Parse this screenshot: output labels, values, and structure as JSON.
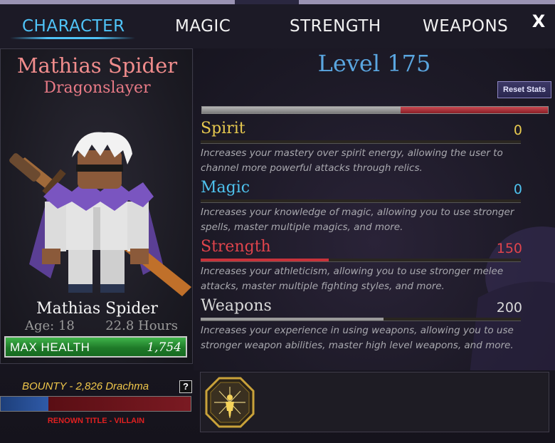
{
  "tabs": [
    {
      "label": "CHARACTER",
      "active": true
    },
    {
      "label": "MAGIC",
      "active": false
    },
    {
      "label": "STRENGTH",
      "active": false
    },
    {
      "label": "WEAPONS",
      "active": false
    }
  ],
  "close_label": "X",
  "character": {
    "name": "Mathias Spider",
    "title": "Dragonslayer",
    "display_name": "Mathias Spider",
    "age": "Age: 18",
    "playtime": "22.8 Hours"
  },
  "health": {
    "label": "MAX HEALTH",
    "value": "1,754"
  },
  "bounty": {
    "text": "BOUNTY - 2,826 Drachma",
    "help_label": "?"
  },
  "renown": {
    "title": "RENOWN TITLE - VILLAIN",
    "fraction": 0.25
  },
  "level": {
    "text": "Level 175",
    "xp_fraction": 0.575
  },
  "reset_button": "Reset Stats",
  "stats": [
    {
      "name": "Spirit",
      "value": "0",
      "fraction": 0.0,
      "color": "#e7c94f",
      "bar_color": "#8a7a2a",
      "desc": "Increases your mastery over spirit energy, allowing the user to channel more powerful attacks through relics."
    },
    {
      "name": "Magic",
      "value": "0",
      "fraction": 0.0,
      "color": "#4ec2ee",
      "bar_color": "#2a7aa0",
      "desc": "Increases your knowledge of magic, allowing you to use stronger spells, master multiple magics, and more."
    },
    {
      "name": "Strength",
      "value": "150",
      "fraction": 0.4,
      "color": "#e0444c",
      "bar_color": "#c8323a",
      "desc": "Increases your athleticism, allowing you to use stronger melee attacks, master multiple fighting styles, and more."
    },
    {
      "name": "Weapons",
      "value": "200",
      "fraction": 0.57,
      "color": "#d9d9d9",
      "bar_color": "#9a9a9a",
      "desc": "Increases your experience in using weapons, allowing you to use stronger weapon abilities, master high level weapons, and more."
    }
  ],
  "skill_icon": "octagon-person-icon"
}
